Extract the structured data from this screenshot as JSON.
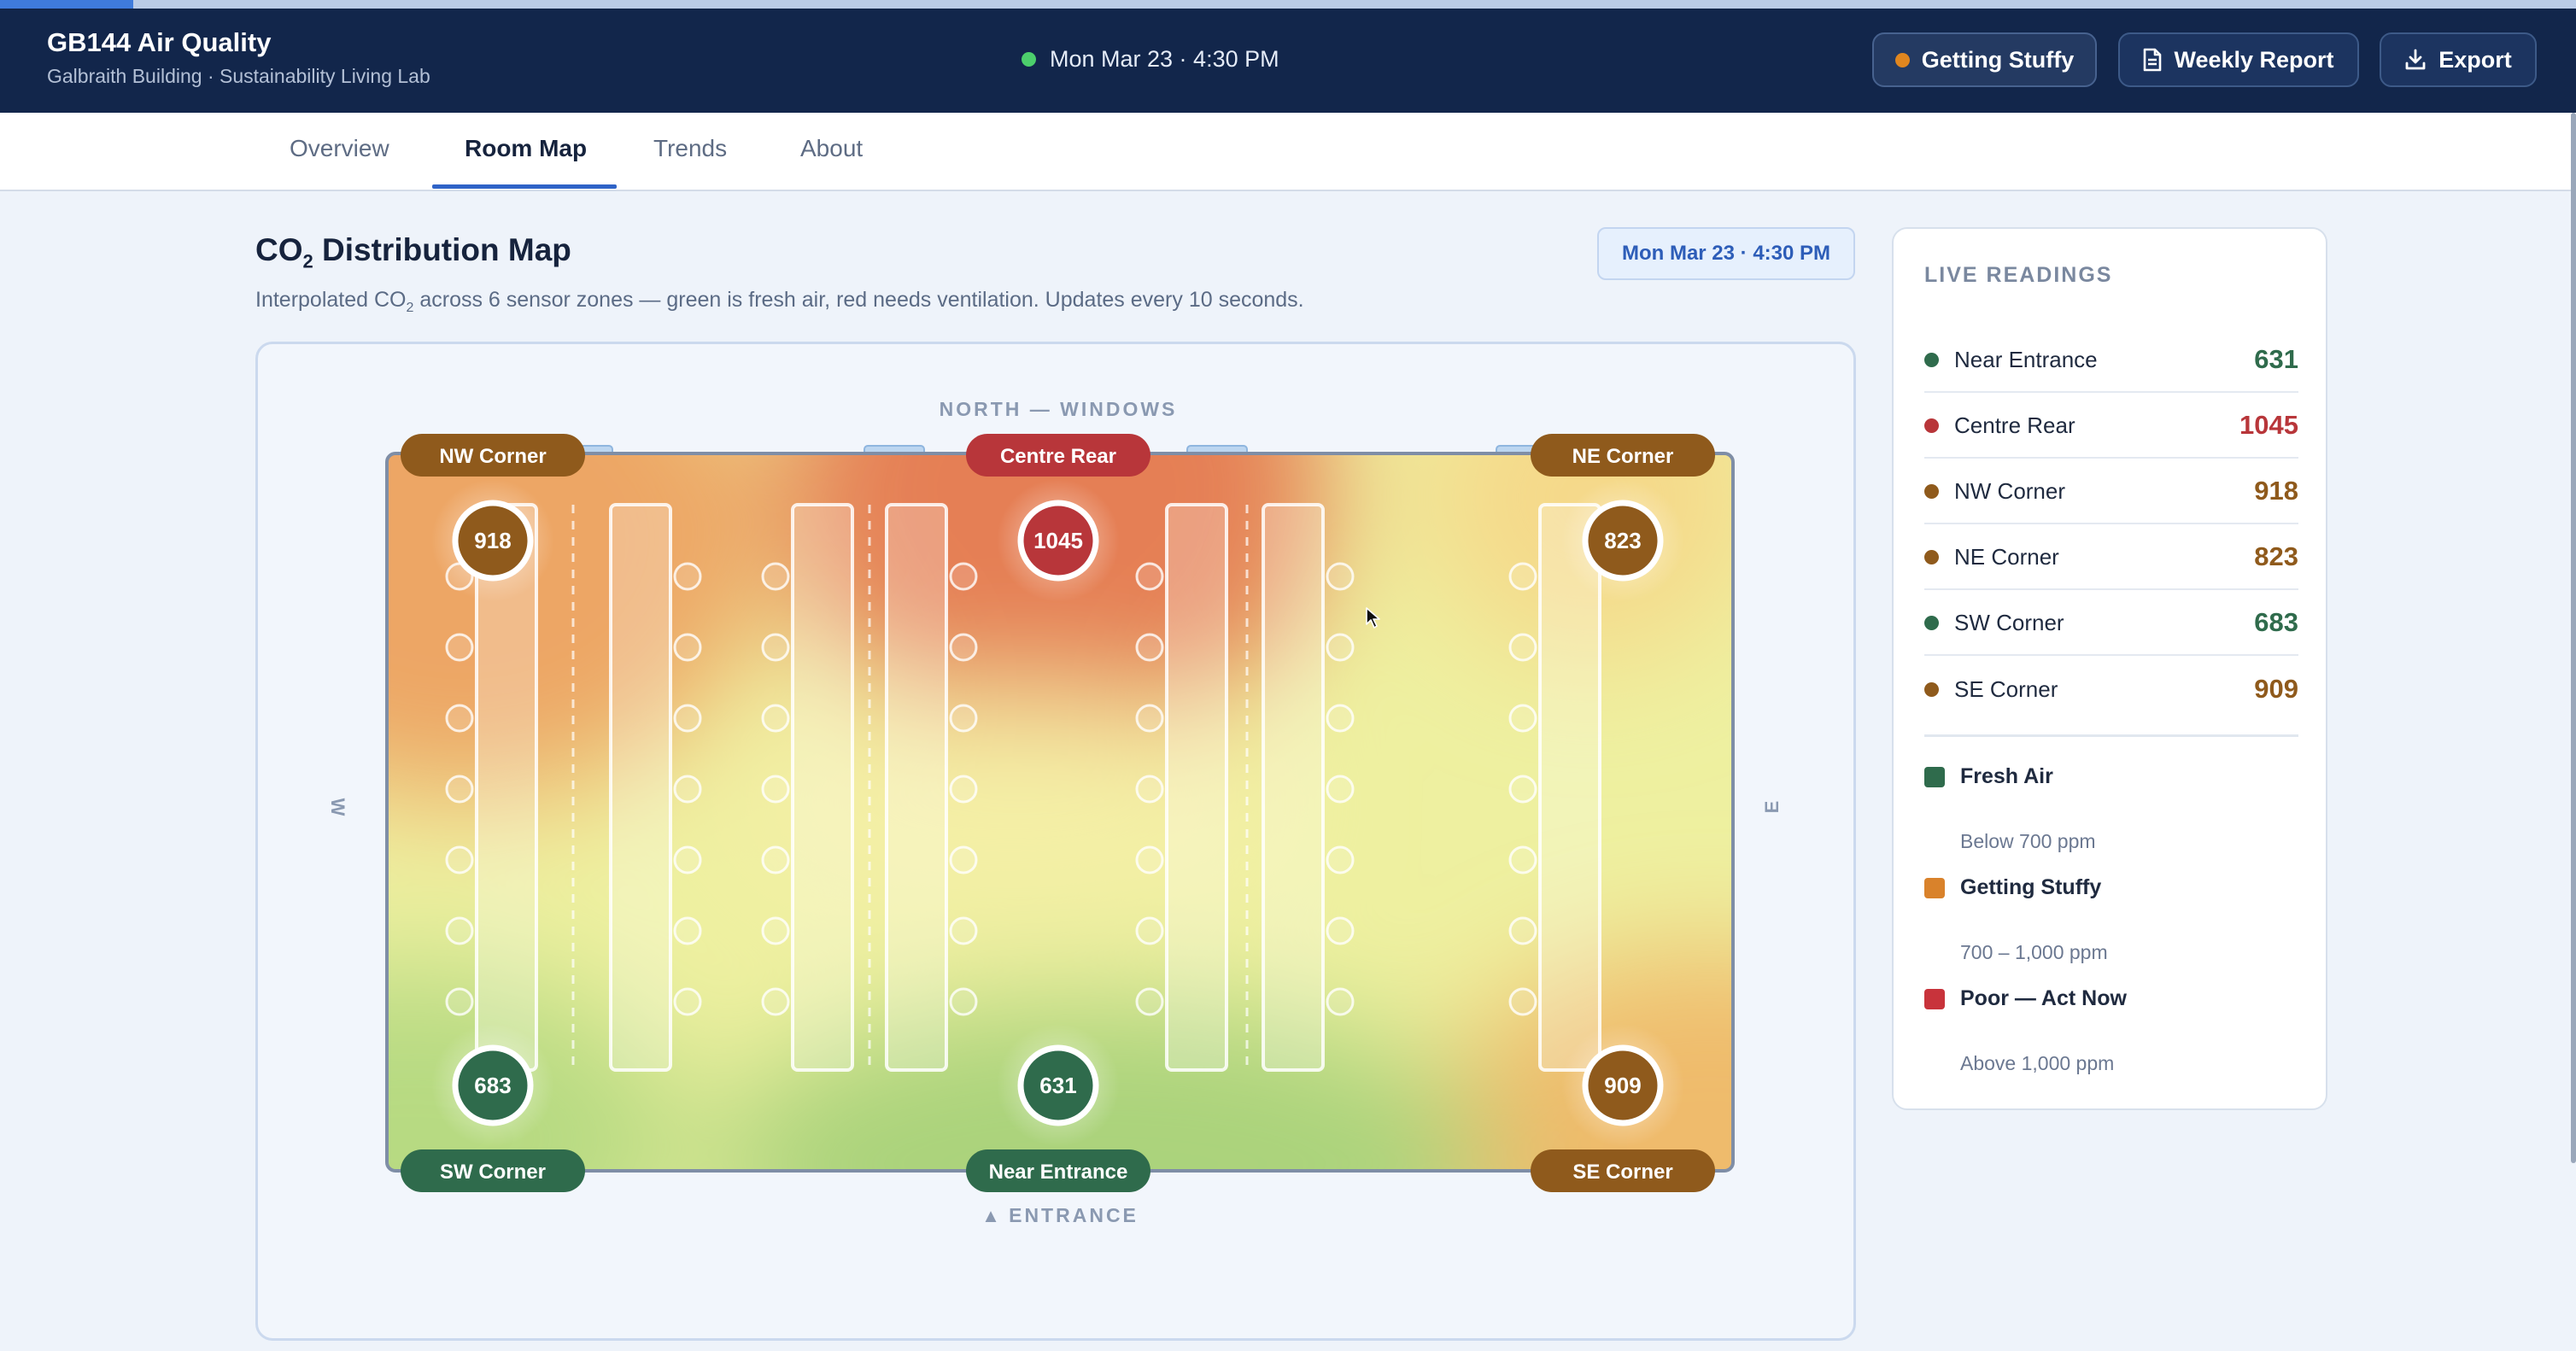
{
  "header": {
    "title": "GB144 Air Quality",
    "subtitle": "Galbraith Building · Sustainability Living Lab",
    "datetime": "Mon Mar 23 · 4:30 PM",
    "status_label": "Getting Stuffy",
    "report_label": "Weekly Report",
    "export_label": "Export"
  },
  "tabs": [
    {
      "label": "Overview"
    },
    {
      "label": "Room Map"
    },
    {
      "label": "Trends"
    },
    {
      "label": "About"
    }
  ],
  "active_tab": "Room Map",
  "page": {
    "title_main": "CO",
    "title_sub": "2",
    "title_rest": " Distribution Map",
    "desc_before": "Interpolated CO",
    "desc_sub": "2",
    "desc_after": " across 6 sensor zones — green is fresh air, red needs ventilation. Updates every 10 seconds.",
    "timestamp": "Mon Mar 23 · 4:30 PM"
  },
  "map": {
    "north_label": "NORTH — WINDOWS",
    "west_label": "W",
    "east_label": "E",
    "entrance_arrow": "▲",
    "entrance_label": "ENTRANCE",
    "sensors": [
      {
        "zone": "NW Corner",
        "value": "918",
        "level": "stuffy"
      },
      {
        "zone": "Centre Rear",
        "value": "1045",
        "level": "poor"
      },
      {
        "zone": "NE Corner",
        "value": "823",
        "level": "stuffy"
      },
      {
        "zone": "SW Corner",
        "value": "683",
        "level": "fresh"
      },
      {
        "zone": "Near Entrance",
        "value": "631",
        "level": "fresh"
      },
      {
        "zone": "SE Corner",
        "value": "909",
        "level": "stuffy"
      }
    ]
  },
  "readings": {
    "title": "LIVE READINGS",
    "items": [
      {
        "name": "Near Entrance",
        "value": "631",
        "level": "fresh"
      },
      {
        "name": "Centre Rear",
        "value": "1045",
        "level": "poor"
      },
      {
        "name": "NW Corner",
        "value": "918",
        "level": "stuffy"
      },
      {
        "name": "NE Corner",
        "value": "823",
        "level": "stuffy"
      },
      {
        "name": "SW Corner",
        "value": "683",
        "level": "fresh"
      },
      {
        "name": "SE Corner",
        "value": "909",
        "level": "stuffy"
      }
    ]
  },
  "legend": [
    {
      "label": "Fresh Air",
      "range": "Below 700 ppm",
      "color": "#2f6b4c"
    },
    {
      "label": "Getting Stuffy",
      "range": "700 – 1,000 ppm",
      "color": "#d9822b"
    },
    {
      "label": "Poor — Act Now",
      "range": "Above 1,000 ppm",
      "color": "#c8333b"
    }
  ],
  "colors": {
    "fresh": "#2f6b4c",
    "stuffy": "#8f5a1c",
    "poor": "#b8363a",
    "fresh_text": "#2f6b4c",
    "stuffy_text": "#8f5a1c",
    "poor_text": "#b8363a",
    "header_bg": "#12264b",
    "accent": "#2f63c7"
  }
}
